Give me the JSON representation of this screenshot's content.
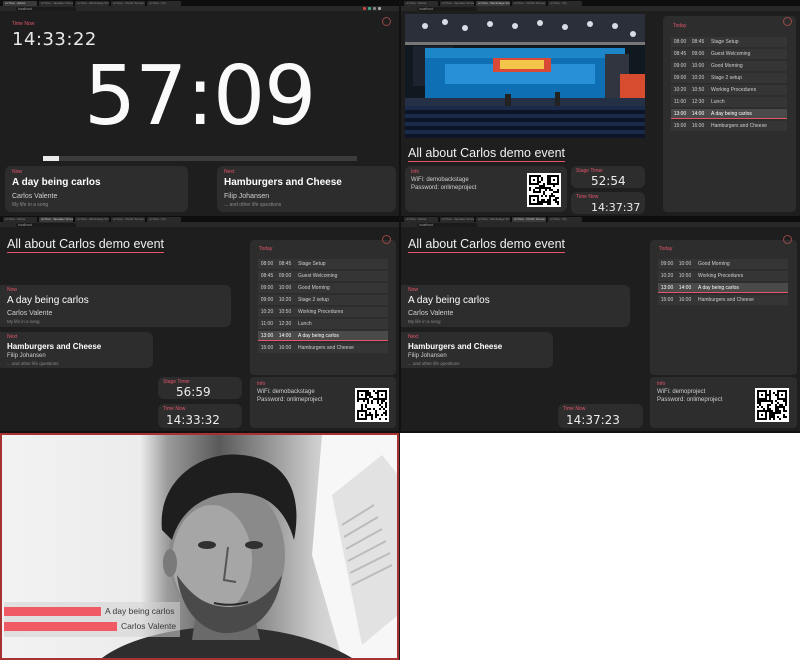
{
  "browser": {
    "tabs": [
      "onTime - Editor",
      "onTime - Speaker Screen",
      "onTime - Backstage Screen",
      "onTime - Public Screen",
      "onTime - Pip"
    ],
    "url": "localhost"
  },
  "stage_timer_view": {
    "time_now_label": "Time Now",
    "time_now": "14:33:22",
    "big_timer": "57:09",
    "progress": 0.05,
    "now_label": "Now",
    "now_title": "A day being carlos",
    "now_presenter": "Carlos Valente",
    "now_subtitle": "My life in a song",
    "next_label": "Next",
    "next_title": "Hamburgers and Cheese",
    "next_presenter": "Filip Johansen",
    "next_subtitle": "... and other life questions"
  },
  "backstage_view": {
    "event_title": "All about Carlos demo event",
    "today_label": "Today",
    "schedule": [
      {
        "start": "08:00",
        "end": "08:45",
        "title": "Stage Setup"
      },
      {
        "start": "08:45",
        "end": "09:00",
        "title": "Guest Welcoming"
      },
      {
        "start": "09:00",
        "end": "10:00",
        "title": "Good Morning"
      },
      {
        "start": "09:00",
        "end": "10:20",
        "title": "Stage 2 setup"
      },
      {
        "start": "10:20",
        "end": "10:50",
        "title": "Working Procedures"
      },
      {
        "start": "11:00",
        "end": "12:30",
        "title": "Lunch"
      },
      {
        "start": "13:00",
        "end": "14:00",
        "title": "A day being carlos"
      },
      {
        "start": "15:00",
        "end": "16:00",
        "title": "Hamburgers and Cheese"
      }
    ],
    "current_index": 6,
    "info_label": "Info",
    "wifi": "WiFi: demobackstage",
    "password": "Password: onlimeproject",
    "stage_timer_label": "Stage Timer",
    "stage_timer": "52:54",
    "time_now_label": "Time Now",
    "time_now": "14:37:37"
  },
  "speaker_view": {
    "event_title": "All about Carlos demo event",
    "now_label": "Now",
    "now_title": "A day being carlos",
    "now_presenter": "Carlos Valente",
    "now_subtitle": "My life in a song",
    "next_label": "Next",
    "next_title": "Hamburgers and Cheese",
    "next_presenter": "Filip Johansen",
    "next_subtitle": "... and other life questions",
    "today_label": "Today",
    "schedule": [
      {
        "start": "08:00",
        "end": "08:45",
        "title": "Stage Setup"
      },
      {
        "start": "08:45",
        "end": "09:00",
        "title": "Guest Welcoming"
      },
      {
        "start": "09:00",
        "end": "10:00",
        "title": "Good Morning"
      },
      {
        "start": "09:00",
        "end": "10:20",
        "title": "Stage 2 setup"
      },
      {
        "start": "10:20",
        "end": "10:50",
        "title": "Working Procedures"
      },
      {
        "start": "11:00",
        "end": "12:30",
        "title": "Lunch"
      },
      {
        "start": "13:00",
        "end": "14:00",
        "title": "A day being carlos"
      },
      {
        "start": "15:00",
        "end": "16:00",
        "title": "Hamburgers and Cheese"
      }
    ],
    "current_index": 6,
    "stage_timer_label": "Stage Timer",
    "stage_timer": "56:59",
    "time_now_label": "Time Now",
    "time_now": "14:33:32",
    "info_label": "Info",
    "wifi": "WiFi: demobackstage",
    "password": "Password: onlimeproject"
  },
  "public_view": {
    "event_title": "All about Carlos demo event",
    "now_label": "Now",
    "now_title": "A day being carlos",
    "now_presenter": "Carlos Valente",
    "now_subtitle": "My life in a song",
    "next_label": "Next",
    "next_title": "Hamburgers and Cheese",
    "next_presenter": "Filip Johansen",
    "next_subtitle": "... and other life questions",
    "today_label": "Today",
    "schedule": [
      {
        "start": "09:00",
        "end": "10:00",
        "title": "Good Morning"
      },
      {
        "start": "10:20",
        "end": "10:50",
        "title": "Working Procedures"
      },
      {
        "start": "13:00",
        "end": "14:00",
        "title": "A day being carlos"
      },
      {
        "start": "15:00",
        "end": "16:00",
        "title": "Hamburgers and Cheese"
      }
    ],
    "current_index": 2,
    "time_now_label": "Time Now",
    "time_now": "14:37:23",
    "info_label": "Info",
    "wifi": "WiFi: demoproject",
    "password": "Password: onlimeproject"
  },
  "lower_third": {
    "title": "A day being carlos",
    "presenter": "Carlos Valente",
    "accent": "#f05a64"
  },
  "colors": {
    "accent": "#e4556a",
    "background": "#1e1e1e",
    "card": "#2d2d2d"
  }
}
